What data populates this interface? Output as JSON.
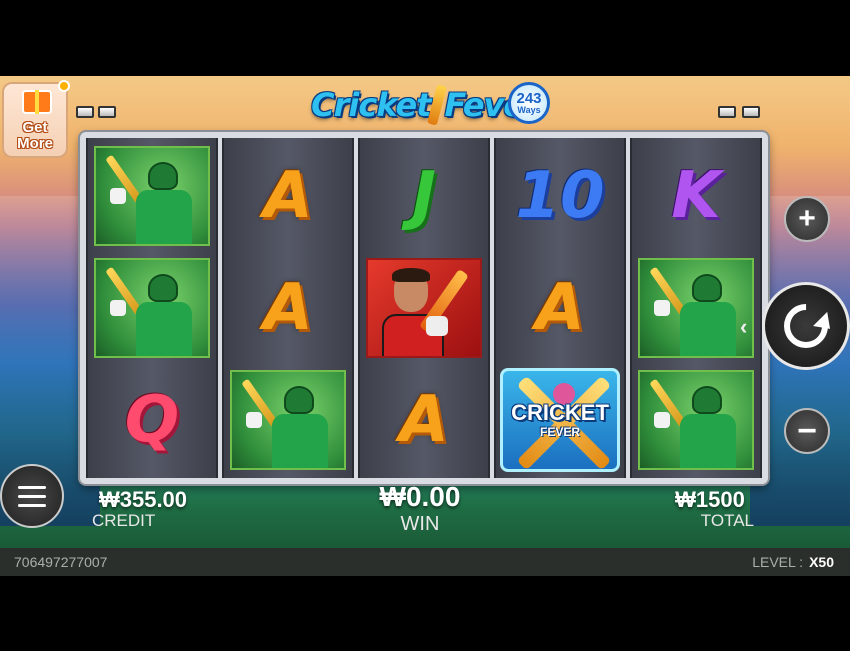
{
  "game": {
    "title_part1": "Cricket",
    "title_part2": "Fever",
    "ways_number": "243",
    "ways_label": "Ways",
    "get_more_label": "Get More"
  },
  "reels": [
    [
      "player",
      "player",
      "Q"
    ],
    [
      "A",
      "A",
      "player"
    ],
    [
      "J",
      "star",
      "A"
    ],
    [
      "10",
      "A",
      "wild"
    ],
    [
      "K",
      "player",
      "player"
    ]
  ],
  "wild": {
    "line1": "CRICKET",
    "line2": "FEVER"
  },
  "controls": {
    "plus_label": "+",
    "minus_label": "−",
    "spin_icon": "refresh-icon",
    "menu_icon": "hamburger-icon"
  },
  "stats": {
    "credit_value": "₩355.00",
    "credit_label": "CREDIT",
    "win_value": "₩0.00",
    "win_label": "WIN",
    "total_value": "₩1500",
    "total_label": "TOTAL"
  },
  "footer": {
    "round_id": "706497277007",
    "level_label": "LEVEL :",
    "level_value": "X50"
  },
  "colors": {
    "symbol_A": "#f7a21a",
    "symbol_J": "#36c83a",
    "symbol_10": "#3d7bf5",
    "symbol_K": "#b055f0",
    "symbol_Q": "#ff4b6e"
  }
}
